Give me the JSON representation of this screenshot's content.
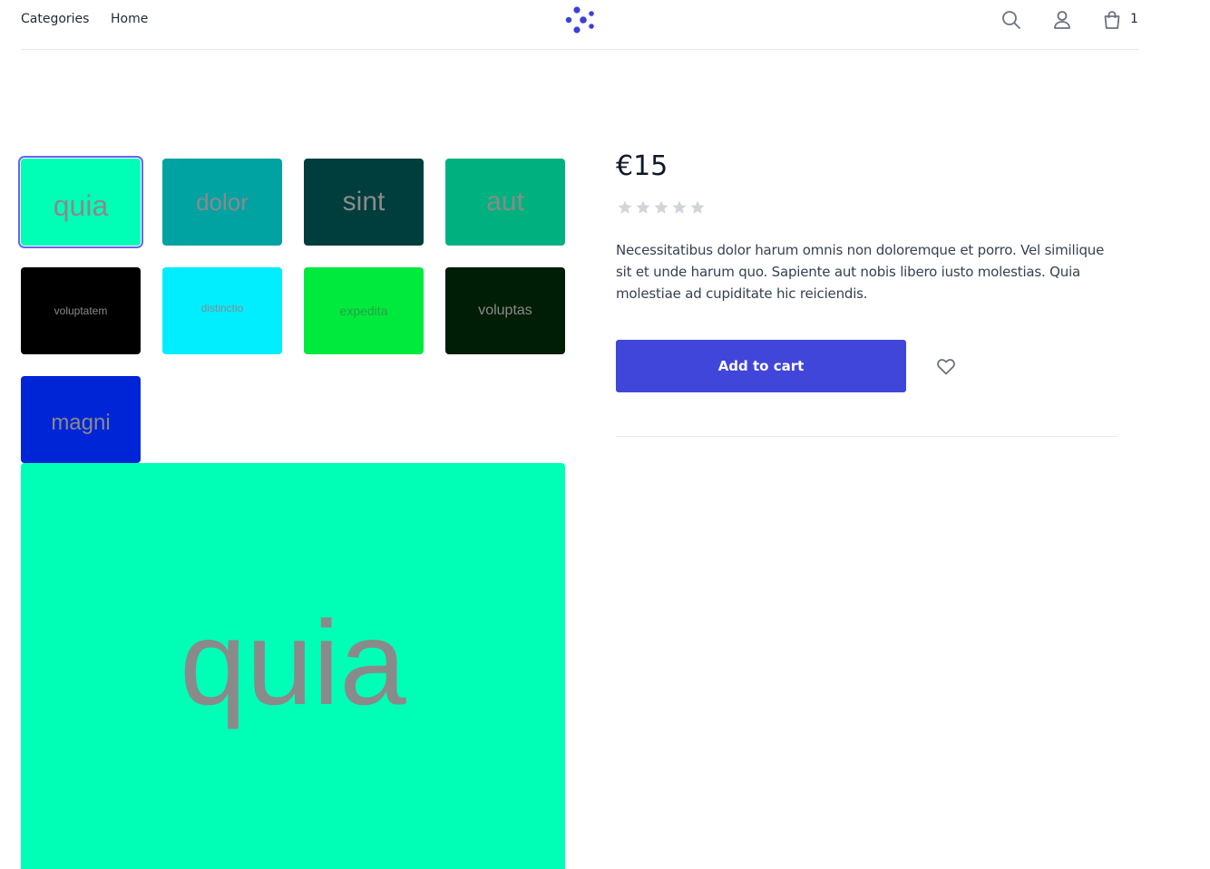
{
  "header": {
    "nav": [
      "Categories",
      "Home"
    ],
    "cart_count": "1",
    "icons": [
      "search-icon",
      "user-icon",
      "shopping-bag-icon"
    ],
    "logo_color": "#3b41d6"
  },
  "gallery": {
    "thumbnails": [
      {
        "label": "quia",
        "color": "#00ffb6",
        "selected": true
      },
      {
        "label": "dolor",
        "color": "#00a2a2"
      },
      {
        "label": "sint",
        "color": "#003d3d"
      },
      {
        "label": "aut",
        "color": "#00b180"
      },
      {
        "label": "voluptatem",
        "color": "#000000"
      },
      {
        "label": "distinctio",
        "color": "#00eeff"
      },
      {
        "label": "expedita",
        "color": "#00ea3d"
      },
      {
        "label": "voluptas",
        "color": "#001d05"
      },
      {
        "label": "magni",
        "color": "#0025d6"
      }
    ],
    "main_label": "quia",
    "main_color": "#00ffb6"
  },
  "product": {
    "price": "€15",
    "rating": 0,
    "rating_max": 5,
    "description": "Necessitatibus dolor harum omnis non doloremque et porro. Vel similique sit et unde harum quo. Sapiente aut nobis libero iusto molestias. Quia molestiae ad cupiditate hic reiciendis.",
    "add_to_cart_label": "Add to cart",
    "accent_color": "#4046d9"
  }
}
